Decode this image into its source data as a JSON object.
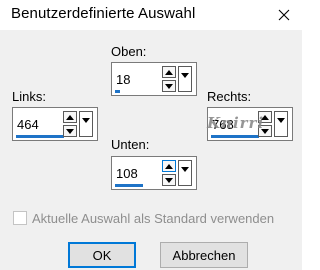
{
  "dialog": {
    "title": "Benutzerdefinierte Auswahl",
    "close_icon": "close-icon"
  },
  "fields": {
    "top": {
      "label": "Oben:",
      "value": "18"
    },
    "left": {
      "label": "Links:",
      "value": "464"
    },
    "right": {
      "label": "Rechts:",
      "value": "768"
    },
    "bottom": {
      "label": "Unten:",
      "value": "108"
    }
  },
  "watermark": "Knirri",
  "checkbox": {
    "label": "Aktuelle Auswahl als Standard verwenden",
    "checked": false
  },
  "buttons": {
    "ok": "OK",
    "cancel": "Abbrechen"
  },
  "colors": {
    "accent": "#1e73c7",
    "dialog_bg": "#f0f0f0",
    "disabled_text": "#8e8e8e"
  }
}
